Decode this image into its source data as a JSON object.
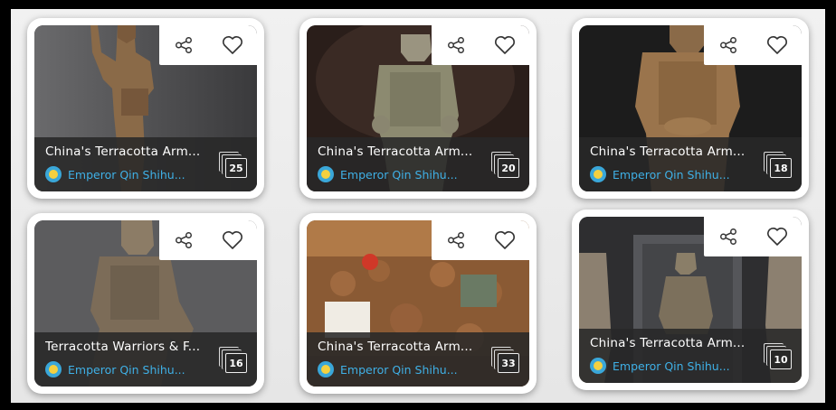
{
  "cards": [
    {
      "title": "China's Terracotta Arm...",
      "author": "Emperor Qin Shihu...",
      "count": "25",
      "image": "terracotta-warrior-raised-arm"
    },
    {
      "title": "China's Terracotta Arm...",
      "author": "Emperor Qin Shihu...",
      "count": "20",
      "image": "terracotta-warrior-standing"
    },
    {
      "title": "China's Terracotta Arm...",
      "author": "Emperor Qin Shihu...",
      "count": "18",
      "image": "terracotta-warrior-armor"
    },
    {
      "title": "Terracotta Warriors & F...",
      "author": "Emperor Qin Shihu...",
      "count": "16",
      "image": "terracotta-kneeling-archer"
    },
    {
      "title": "China's Terracotta Arm...",
      "author": "Emperor Qin Shihu...",
      "count": "33",
      "image": "excavation-workers"
    },
    {
      "title": "China's Terracotta Arm...",
      "author": "Emperor Qin Shihu...",
      "count": "10",
      "image": "kneeling-archer-gallery"
    }
  ],
  "icons": {
    "share": "share-icon",
    "favorite": "heart-icon",
    "gallery_count": "image-stack-icon",
    "avatar": "sun-avatar-icon"
  },
  "colors": {
    "author_link": "#3fb0e6",
    "footer_bg": "#282828",
    "background": "#eeeeee"
  }
}
